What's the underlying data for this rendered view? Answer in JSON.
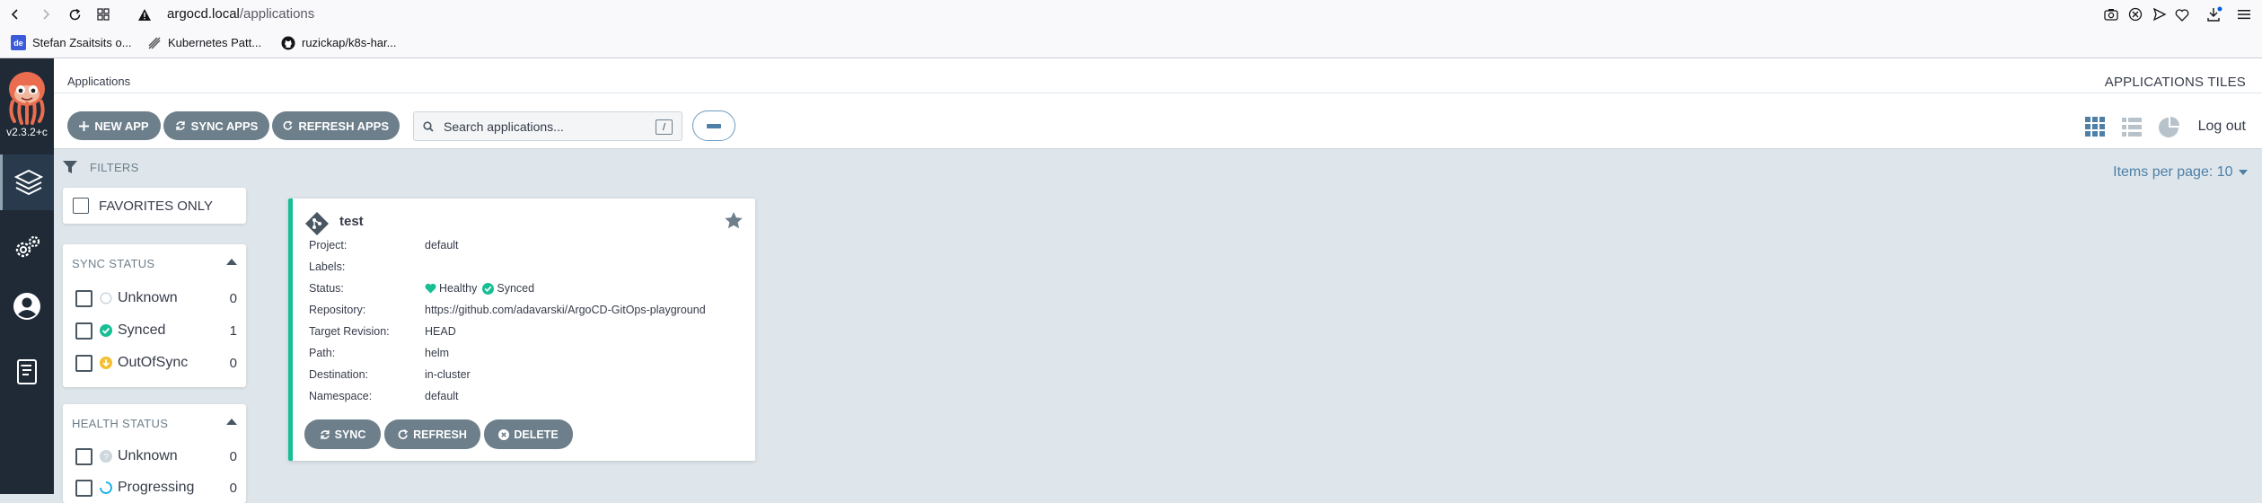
{
  "browser": {
    "url_host": "argocd.local",
    "url_path": "/applications",
    "bookmarks": [
      {
        "label": "Stefan Zsaitsits o...",
        "icon": "bookmark-favicon-icon"
      },
      {
        "label": "Kubernetes Patt...",
        "icon": "kubernetes-patterns-icon"
      },
      {
        "label": "ruzickap/k8s-har...",
        "icon": "github-icon"
      }
    ]
  },
  "sidebar": {
    "version": "v2.3.2+c"
  },
  "header": {
    "breadcrumb": "Applications",
    "title": "APPLICATIONS TILES"
  },
  "toolbar": {
    "new_app": "NEW APP",
    "sync_apps": "SYNC APPS",
    "refresh_apps": "REFRESH APPS",
    "search_placeholder": "Search applications...",
    "search_key": "/",
    "logout": "Log out"
  },
  "filters": {
    "heading": "FILTERS",
    "favorites_only": "FAVORITES ONLY",
    "sync_status": {
      "title": "SYNC STATUS",
      "items": [
        {
          "label": "Unknown",
          "count": "0"
        },
        {
          "label": "Synced",
          "count": "1"
        },
        {
          "label": "OutOfSync",
          "count": "0"
        }
      ]
    },
    "health_status": {
      "title": "HEALTH STATUS",
      "items": [
        {
          "label": "Unknown",
          "count": "0"
        },
        {
          "label": "Progressing",
          "count": "0"
        }
      ]
    }
  },
  "items_per_page": "Items per page: 10",
  "app": {
    "name": "test",
    "fields": {
      "project_label": "Project:",
      "project": "default",
      "labels_label": "Labels:",
      "labels": "",
      "status_label": "Status:",
      "health": "Healthy",
      "sync": "Synced",
      "repository_label": "Repository:",
      "repository": "https://github.com/adavarski/ArgoCD-GitOps-playground",
      "target_revision_label": "Target Revision:",
      "target_revision": "HEAD",
      "path_label": "Path:",
      "path": "helm",
      "destination_label": "Destination:",
      "destination": "in-cluster",
      "namespace_label": "Namespace:",
      "namespace": "default"
    },
    "actions": {
      "sync": "SYNC",
      "refresh": "REFRESH",
      "delete": "DELETE"
    }
  },
  "colors": {
    "healthy": "#18be94",
    "synced": "#18be94",
    "outofsync": "#f4c030",
    "button": "#6d7f8b",
    "link": "#4d7fa7"
  }
}
